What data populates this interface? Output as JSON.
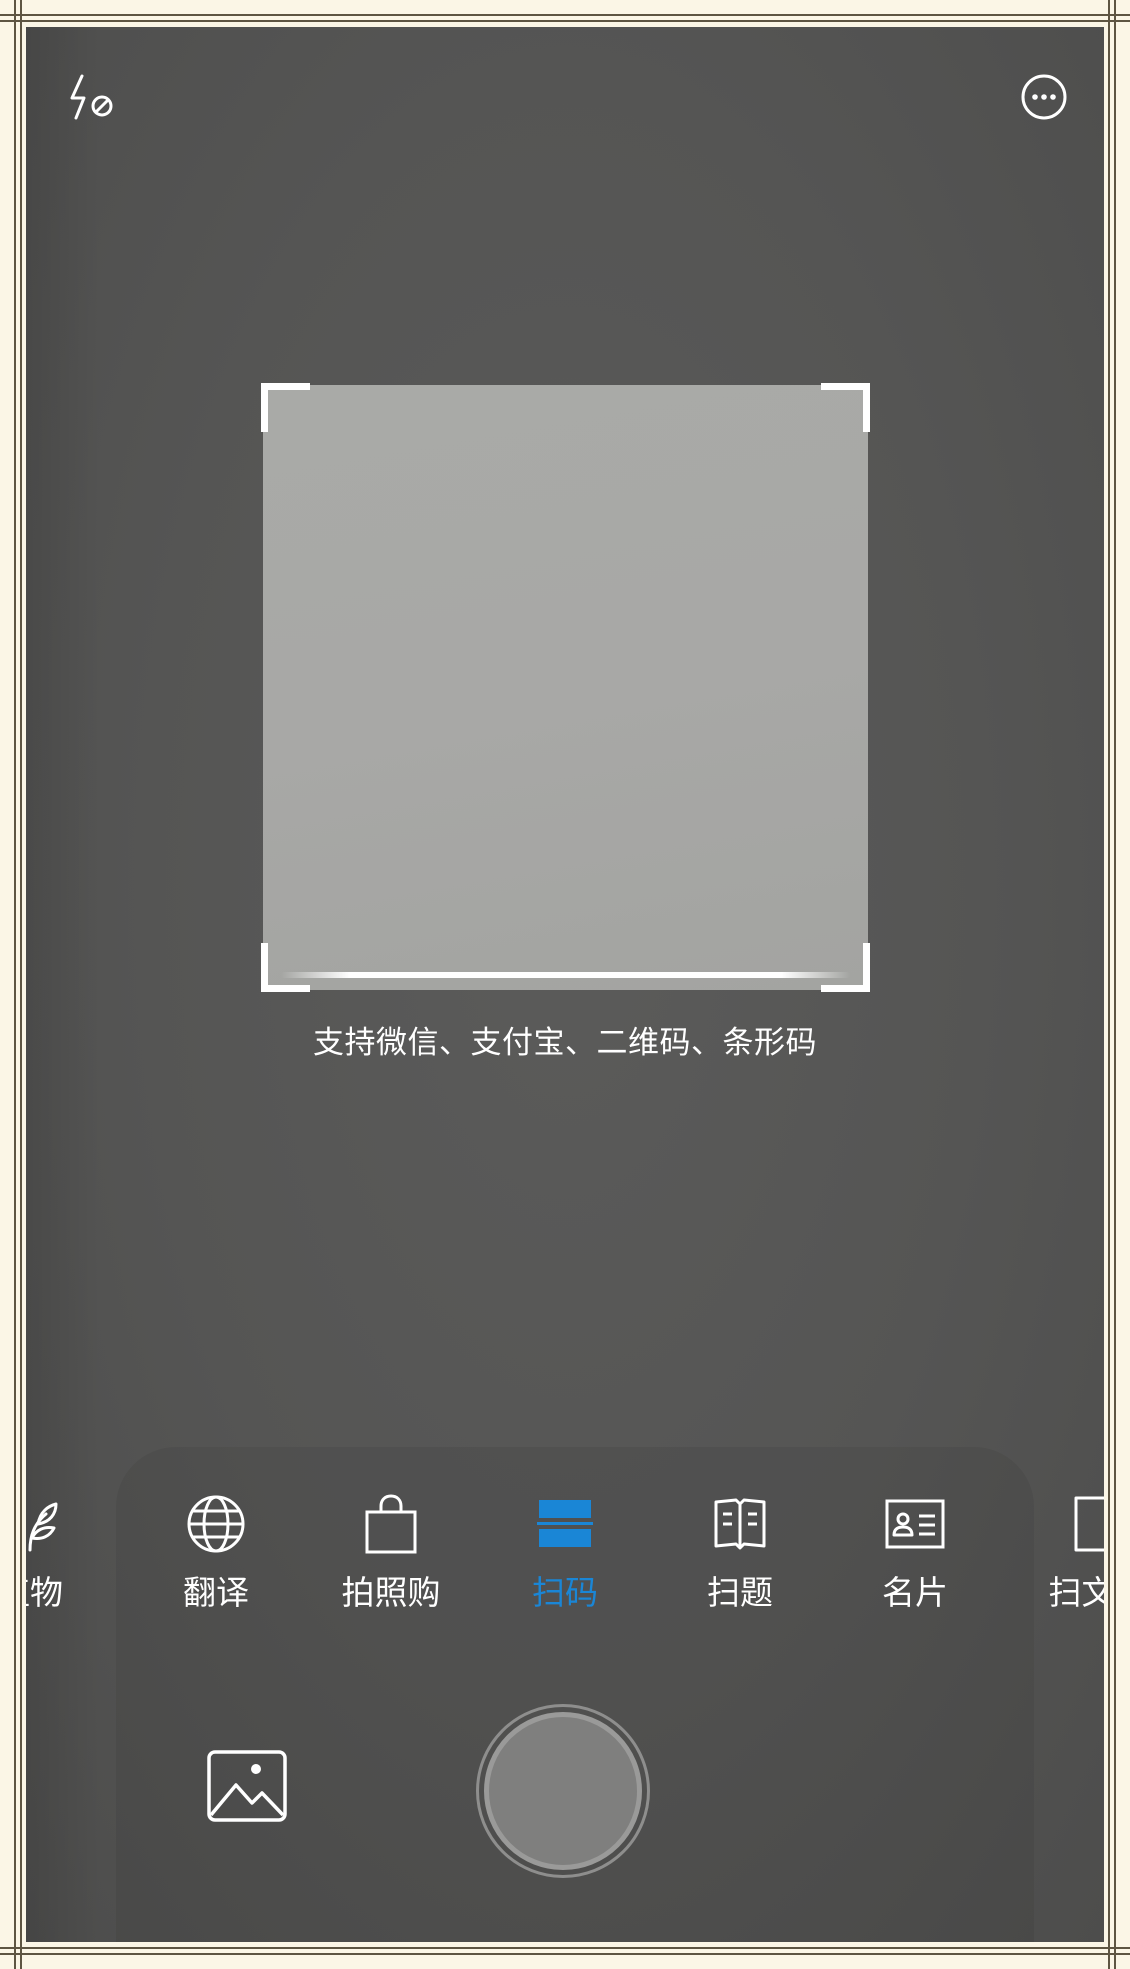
{
  "camera": {
    "hint_text": "支持微信、支付宝、二维码、条形码"
  },
  "top_bar": {
    "flash_icon": "flash-off-icon",
    "more_icon": "more-options-icon"
  },
  "modes": [
    {
      "label": "植物",
      "icon": "plant-icon",
      "active": false
    },
    {
      "label": "翻译",
      "icon": "globe-icon",
      "active": false
    },
    {
      "label": "拍照购",
      "icon": "shopping-bag-icon",
      "active": false
    },
    {
      "label": "扫码",
      "icon": "scan-code-icon",
      "active": true
    },
    {
      "label": "扫题",
      "icon": "open-book-icon",
      "active": false
    },
    {
      "label": "名片",
      "icon": "business-card-icon",
      "active": false
    },
    {
      "label": "扫文件",
      "icon": "document-icon",
      "active": false
    }
  ],
  "bottom_bar": {
    "gallery_icon": "gallery-icon",
    "shutter": "shutter-button"
  },
  "colors": {
    "active": "#1a86d6",
    "text": "#ffffff",
    "background": "#555554",
    "scan_area": "#a8a8a6"
  }
}
